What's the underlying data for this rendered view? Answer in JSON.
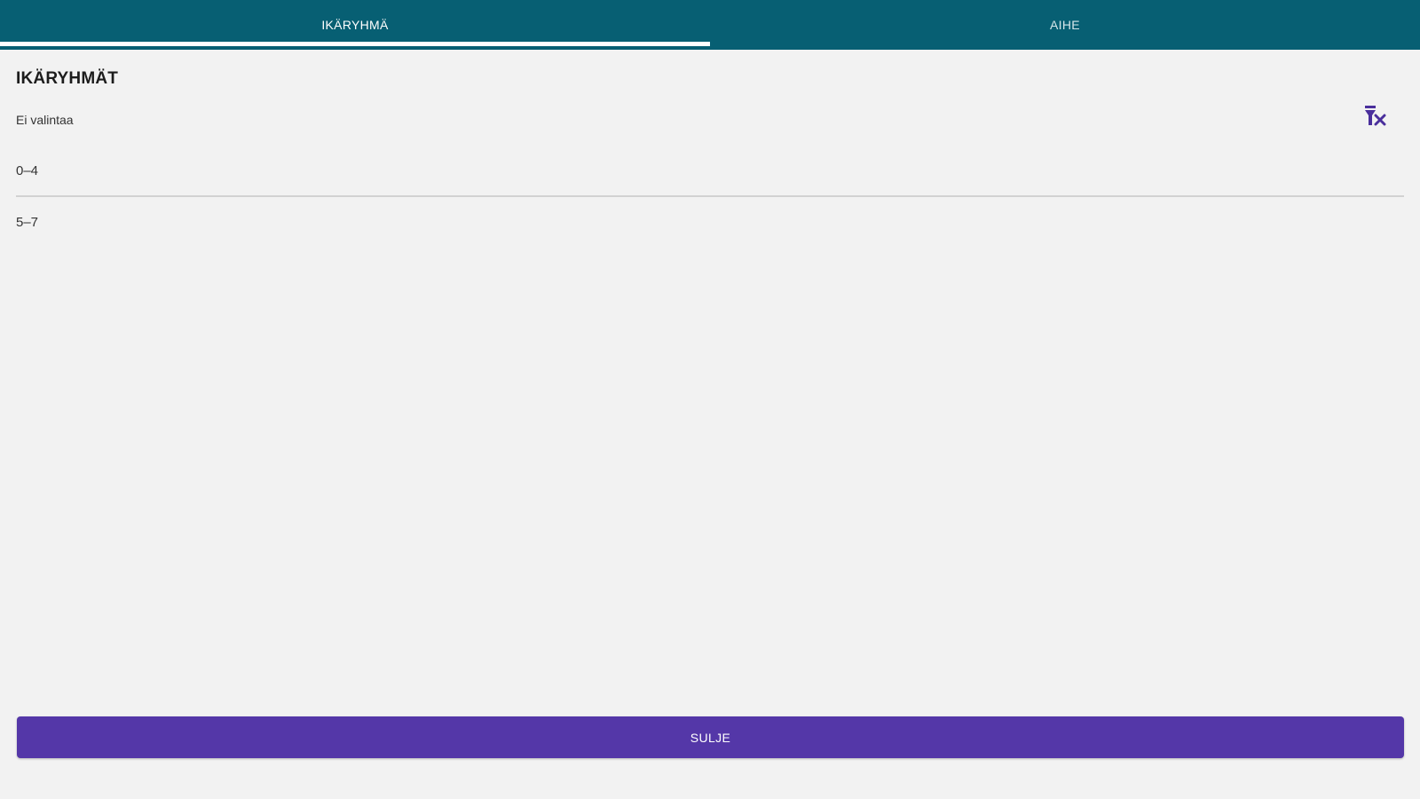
{
  "tabs": [
    {
      "label": "IKÄRYHMÄ",
      "active": true
    },
    {
      "label": "AIHE",
      "active": false
    }
  ],
  "section": {
    "title": "IKÄRYHMÄT",
    "selection_status": "Ei valintaa",
    "clear_icon": "filter-clear-icon"
  },
  "options": [
    {
      "label": "0–4"
    },
    {
      "label": "5–7"
    }
  ],
  "footer": {
    "close_label": "SULJE"
  },
  "colors": {
    "tabbar": "#075f73",
    "accent": "#5437a8",
    "background": "#f2f2f2"
  }
}
